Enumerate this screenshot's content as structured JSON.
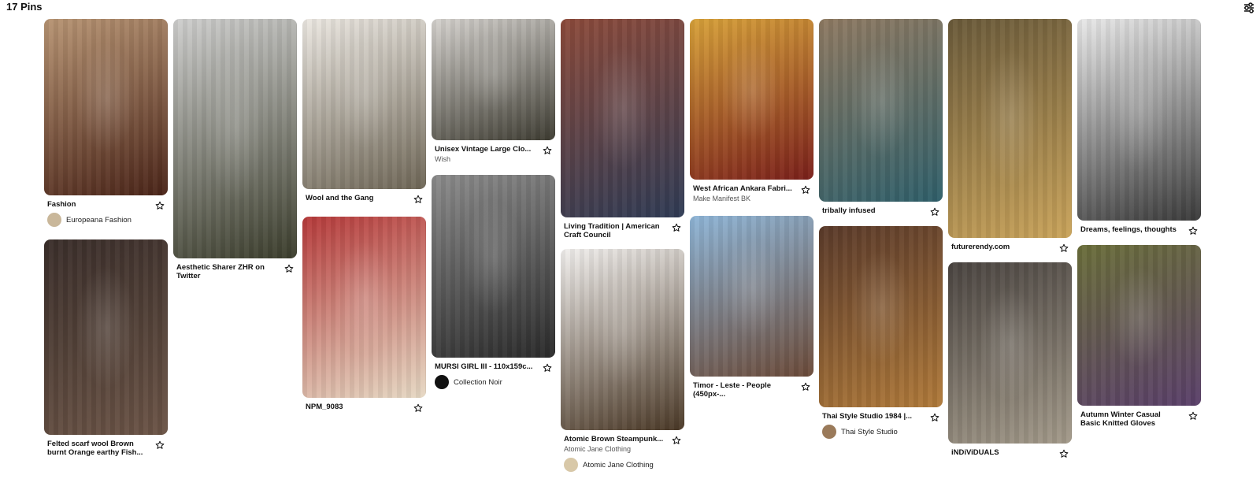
{
  "header": {
    "title": "17 Pins",
    "filter_icon": "filter-sliders-icon"
  },
  "columns": [
    {
      "pins": [
        {
          "title": "Fashion",
          "source": "Europeana Fashion",
          "colors": [
            "#b89574",
            "#4a2418"
          ]
        },
        {
          "title": "Felted scarf wool Brown burnt Orange earthy Fish...",
          "colors": [
            "#3a2e2a",
            "#6b5446"
          ]
        }
      ]
    },
    {
      "pins": [
        {
          "title": "Aesthetic Sharer ZHR on Twitter",
          "colors": [
            "#cfcfce",
            "#3b3d2c"
          ]
        }
      ]
    },
    {
      "pins": [
        {
          "title": "Wool and the Gang",
          "colors": [
            "#ece8e2",
            "#6e6656"
          ]
        },
        {
          "title": "NPM_9083",
          "colors": [
            "#b63a3a",
            "#e6d9c4"
          ]
        }
      ]
    },
    {
      "pins": [
        {
          "title": "Unisex Vintage Large Clo...",
          "subtitle": "Wish",
          "colors": [
            "#d6d3cf",
            "#3e3c32"
          ]
        },
        {
          "title": "MURSI GIRL III - 110x159c...",
          "source": "Collection Noir",
          "colors": [
            "#8c8c8c",
            "#2a2a2a"
          ]
        }
      ]
    },
    {
      "pins": [
        {
          "title": "Living Tradition | American Craft Council",
          "colors": [
            "#8d4b3b",
            "#2f3b55"
          ]
        },
        {
          "title": "Atomic Brown Steampunk...",
          "subtitle": "Atomic Jane Clothing",
          "source": "Atomic Jane Clothing",
          "colors": [
            "#f2f0ee",
            "#4a3826"
          ]
        }
      ]
    },
    {
      "pins": [
        {
          "title": "West African Ankara Fabri...",
          "subtitle": "Make Manifest BK",
          "colors": [
            "#d8a23a",
            "#7a1f1a"
          ]
        },
        {
          "title": "Timor - Leste - People (450px-...",
          "colors": [
            "#8fb6d8",
            "#6b4a38"
          ]
        }
      ]
    },
    {
      "pins": [
        {
          "title": "tribally infused",
          "colors": [
            "#8f7a62",
            "#2f5f6a"
          ]
        },
        {
          "title": "Thai Style Studio 1984 |...",
          "source": "Thai Style Studio",
          "colors": [
            "#5a3a2a",
            "#b07a3a"
          ]
        }
      ]
    },
    {
      "pins": [
        {
          "title": "futurerendy.com",
          "colors": [
            "#6a5a3a",
            "#c9a35a"
          ]
        },
        {
          "title": "iNDiViDUALS",
          "colors": [
            "#4a4440",
            "#a39a8a"
          ]
        }
      ]
    },
    {
      "pins": [
        {
          "title": "Dreams, feelings, thoughts",
          "colors": [
            "#e9e9e9",
            "#3a3a3a"
          ]
        },
        {
          "title": "Autumn Winter Casual Basic Knitted Gloves",
          "colors": [
            "#6a6e3a",
            "#5a3f6a"
          ]
        }
      ]
    }
  ]
}
